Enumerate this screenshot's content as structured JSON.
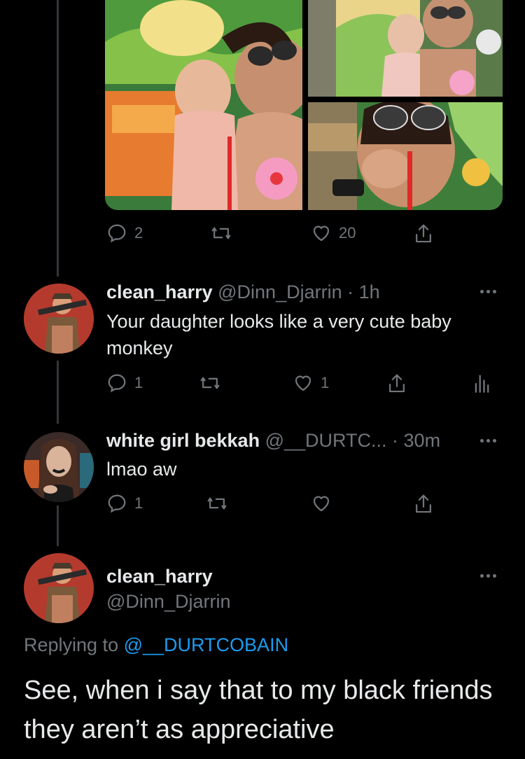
{
  "top_tweet": {
    "actions": {
      "replies": "2",
      "retweets": "",
      "likes": "20"
    }
  },
  "reply1": {
    "display_name": "clean_harry",
    "handle": "@Dinn_Djarrin",
    "time": "· 1h",
    "text": "Your daughter looks like a very cute baby monkey",
    "actions": {
      "replies": "1",
      "likes": "1"
    }
  },
  "reply2": {
    "display_name": "white girl bekkah",
    "handle": "@__DURTC...",
    "time": "· 30m",
    "text": "lmao aw",
    "actions": {
      "replies": "1"
    }
  },
  "main_tweet": {
    "display_name": "clean_harry",
    "handle": "@Dinn_Djarrin",
    "replying_prefix": "Replying to",
    "replying_to": "@__DURTCOBAIN",
    "text": "See, when i say that to my black friends they aren’t as appreciative"
  },
  "colors": {
    "background": "#000000",
    "muted": "#71767b",
    "link": "#1d9bf0",
    "thread_line": "#333639"
  },
  "icons": [
    "reply-icon",
    "retweet-icon",
    "like-icon",
    "share-icon",
    "analytics-icon",
    "more-icon"
  ]
}
